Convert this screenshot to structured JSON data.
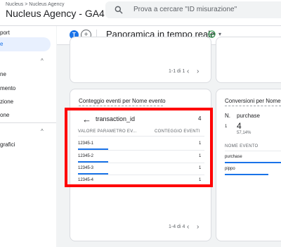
{
  "topbar": {
    "breadcrumb": "Nucleus > Nucleus Agency",
    "account_name": "Nucleus Agency - GA4",
    "search_placeholder": "Prova a cercare \"ID misurazione\""
  },
  "sidebar": {
    "items": [
      "port",
      "e",
      "ne",
      "mento",
      "zione",
      "one",
      "grafici"
    ]
  },
  "subheader": {
    "segment_badge": "T",
    "title": "Panoramica in tempo reale"
  },
  "top_card": {
    "pagination": "1-1 di 1"
  },
  "events_card": {
    "title": "Conteggio eventi per Nome evento",
    "param_name": "transaction_id",
    "param_count": "4",
    "col_param": "VALORE PARAMETRO EV...",
    "col_count": "CONTEGGIO EVENTI",
    "rows": [
      {
        "value": "12345-1",
        "count": "1"
      },
      {
        "value": "12345-2",
        "count": "1"
      },
      {
        "value": "12345-3",
        "count": "1"
      },
      {
        "value": "12345-4",
        "count": "1"
      }
    ],
    "pagination": "1-4 di 4"
  },
  "conversions_card": {
    "title": "Conversioni per Nome",
    "col_n": "N.",
    "event": "purchase",
    "rank": "1",
    "count": "4",
    "percent": "57,14%",
    "col_event": "NOME EVENTO",
    "list": [
      "purchase",
      "pippo"
    ]
  },
  "colors": {
    "accent": "#1a73e8",
    "highlight": "#ff0000",
    "success": "#1e8e3e"
  }
}
